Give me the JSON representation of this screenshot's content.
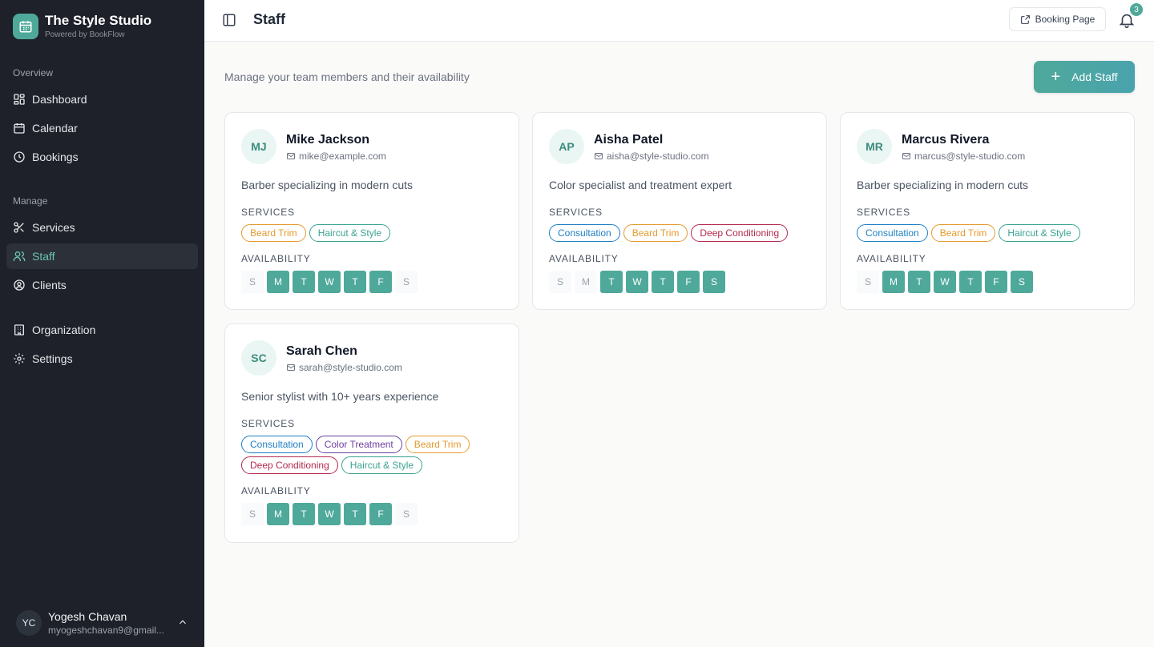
{
  "brand": {
    "name": "The Style Studio",
    "tagline": "Powered by BookFlow",
    "logo_icon": "calendar-icon"
  },
  "sidebar": {
    "overview_label": "Overview",
    "manage_label": "Manage",
    "items": [
      {
        "label": "Dashboard",
        "icon": "dashboard-icon"
      },
      {
        "label": "Calendar",
        "icon": "calendar-icon"
      },
      {
        "label": "Bookings",
        "icon": "clock-icon"
      },
      {
        "label": "Services",
        "icon": "scissors-icon"
      },
      {
        "label": "Staff",
        "icon": "users-icon",
        "active": true
      },
      {
        "label": "Clients",
        "icon": "user-circle-icon"
      },
      {
        "label": "Organization",
        "icon": "building-icon"
      },
      {
        "label": "Settings",
        "icon": "gear-icon"
      }
    ],
    "user": {
      "initials": "YC",
      "name": "Yogesh Chavan",
      "email": "myogeshchavan9@gmail..."
    }
  },
  "header": {
    "title": "Staff",
    "booking_page_label": "Booking Page",
    "notification_count": "3"
  },
  "main": {
    "subtitle": "Manage your team members and their availability",
    "add_staff_label": "Add Staff",
    "services_label": "SERVICES",
    "availability_label": "AVAILABILITY"
  },
  "colors": {
    "accent": "#4fa99a",
    "sidebar_bg": "#1e2129",
    "tag_consultation": "#1d7fc4",
    "tag_beard_trim": "#e49a2e",
    "tag_haircut_style": "#3aa391",
    "tag_deep_conditioning": "#b4284f",
    "tag_color_treatment": "#6b3fa0"
  },
  "staff": [
    {
      "initials": "MJ",
      "name": "Mike Jackson",
      "email": "mike@example.com",
      "description": "Barber specializing in modern cuts",
      "services": [
        "Beard Trim",
        "Haircut & Style"
      ],
      "availability": [
        {
          "day": "S",
          "on": false
        },
        {
          "day": "M",
          "on": true
        },
        {
          "day": "T",
          "on": true
        },
        {
          "day": "W",
          "on": true
        },
        {
          "day": "T",
          "on": true
        },
        {
          "day": "F",
          "on": true
        },
        {
          "day": "S",
          "on": false
        }
      ]
    },
    {
      "initials": "AP",
      "name": "Aisha Patel",
      "email": "aisha@style-studio.com",
      "description": "Color specialist and treatment expert",
      "services": [
        "Consultation",
        "Beard Trim",
        "Deep Conditioning"
      ],
      "availability": [
        {
          "day": "S",
          "on": false
        },
        {
          "day": "M",
          "on": false
        },
        {
          "day": "T",
          "on": true
        },
        {
          "day": "W",
          "on": true
        },
        {
          "day": "T",
          "on": true
        },
        {
          "day": "F",
          "on": true
        },
        {
          "day": "S",
          "on": true
        }
      ]
    },
    {
      "initials": "MR",
      "name": "Marcus Rivera",
      "email": "marcus@style-studio.com",
      "description": "Barber specializing in modern cuts",
      "services": [
        "Consultation",
        "Beard Trim",
        "Haircut & Style"
      ],
      "availability": [
        {
          "day": "S",
          "on": false
        },
        {
          "day": "M",
          "on": true
        },
        {
          "day": "T",
          "on": true
        },
        {
          "day": "W",
          "on": true
        },
        {
          "day": "T",
          "on": true
        },
        {
          "day": "F",
          "on": true
        },
        {
          "day": "S",
          "on": true
        }
      ]
    },
    {
      "initials": "SC",
      "name": "Sarah Chen",
      "email": "sarah@style-studio.com",
      "description": "Senior stylist with 10+ years experience",
      "services": [
        "Consultation",
        "Color Treatment",
        "Beard Trim",
        "Deep Conditioning",
        "Haircut & Style"
      ],
      "availability": [
        {
          "day": "S",
          "on": false
        },
        {
          "day": "M",
          "on": true
        },
        {
          "day": "T",
          "on": true
        },
        {
          "day": "W",
          "on": true
        },
        {
          "day": "T",
          "on": true
        },
        {
          "day": "F",
          "on": true
        },
        {
          "day": "S",
          "on": false
        }
      ]
    }
  ]
}
